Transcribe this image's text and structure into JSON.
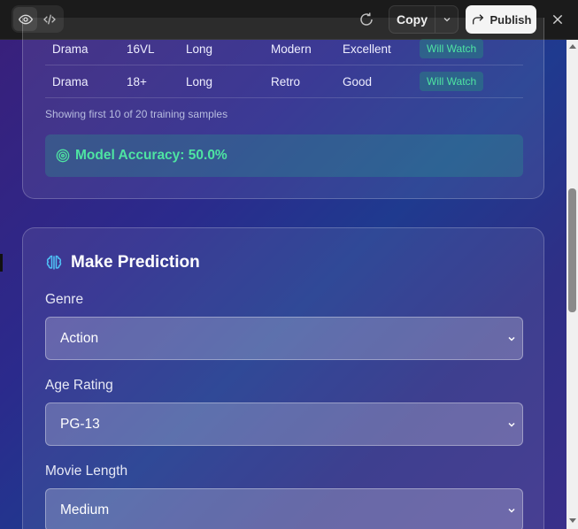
{
  "toolbar": {
    "copy_label": "Copy",
    "publish_label": "Publish"
  },
  "training_table": {
    "rows": [
      {
        "genre": "Drama",
        "age_rating": "16VL",
        "length": "Long",
        "style": "Modern",
        "reviews": "Excellent",
        "result": "Will Watch"
      },
      {
        "genre": "Drama",
        "age_rating": "18+",
        "length": "Long",
        "style": "Retro",
        "reviews": "Good",
        "result": "Will Watch"
      }
    ],
    "note": "Showing first 10 of 20 training samples"
  },
  "accuracy": {
    "text": "Model Accuracy: 50.0%"
  },
  "prediction": {
    "title": "Make Prediction",
    "fields": [
      {
        "label": "Genre",
        "value": "Action"
      },
      {
        "label": "Age Rating",
        "value": "PG-13"
      },
      {
        "label": "Movie Length",
        "value": "Medium"
      }
    ]
  },
  "colors": {
    "accent_green": "#4ee4a2",
    "brain_icon": "#4fc3f7"
  }
}
